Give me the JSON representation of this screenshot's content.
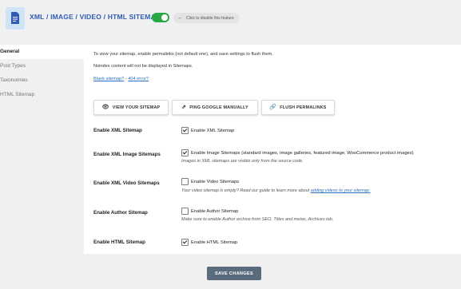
{
  "header": {
    "title": "XML / IMAGE / VIDEO / HTML SITEMAP",
    "toggle_on": true,
    "hint": "Click to disable this feature",
    "accent": "#2f5bb7",
    "toggle_color": "#28a745",
    "icons": {
      "logo": "document-icon",
      "hint_arrow": "arrow-left-icon"
    }
  },
  "sidebar": {
    "items": [
      {
        "label": "General",
        "active": true
      },
      {
        "label": "Post Types",
        "active": false
      },
      {
        "label": "Taxonomies",
        "active": false
      },
      {
        "label": "HTML Sitemap",
        "active": false
      }
    ]
  },
  "intro": {
    "line1": "To view your sitemap, enable permalinks (not default one), and save settings to flush them.",
    "line2": "Noindex content will not be displayed in Sitemaps.",
    "blank_link": "Blank sitemap?",
    "separator": " - ",
    "error_link": "404 error?"
  },
  "actions": {
    "view": {
      "label": "VIEW YOUR SITEMAP",
      "icon": "eye-icon"
    },
    "ping": {
      "label": "PING GOOGLE MANUALLY",
      "icon": "external-link-icon"
    },
    "flush": {
      "label": "FLUSH PERMALINKS",
      "icon": "link-icon"
    }
  },
  "settings": {
    "xml": {
      "label": "Enable XML Sitemap",
      "checkbox": "Enable XML Sitemap",
      "checked": true
    },
    "image": {
      "label": "Enable XML Image Sitemaps",
      "checkbox": "Enable Image Sitemaps (standard images, image galleries, featured image, WooCommerce product images)",
      "checked": true,
      "desc": "Images in XML sitemaps are visible only from the source code."
    },
    "video": {
      "label": "Enable XML Video Sitemaps",
      "checkbox": "Enable Video Sitemaps",
      "checked": false,
      "desc": "Your video sitemap is empty? Read our guide to learn more about ",
      "desc_link": "adding videos to your sitemap."
    },
    "author": {
      "label": "Enable Author Sitemap",
      "checkbox": "Enable Author Sitemap",
      "checked": false,
      "desc": "Make sure to enable Author archive from SEO, Titles and metas, Archives tab."
    },
    "html": {
      "label": "Enable HTML Sitemap",
      "checkbox": "Enable HTML Sitemap",
      "checked": true
    }
  },
  "footer": {
    "save_label": "SAVE CHANGES",
    "save_color": "#5b6b7e"
  }
}
